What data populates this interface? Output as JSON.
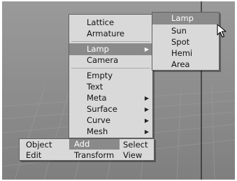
{
  "add_menu": {
    "items": [
      {
        "label": "Lattice"
      },
      {
        "label": "Armature"
      },
      {
        "label": "Lamp"
      },
      {
        "label": "Camera"
      },
      {
        "label": "Empty"
      },
      {
        "label": "Text"
      },
      {
        "label": "Meta"
      },
      {
        "label": "Surface"
      },
      {
        "label": "Curve"
      },
      {
        "label": "Mesh"
      }
    ],
    "highlighted": "Lamp"
  },
  "lamp_submenu": {
    "title": "Lamp",
    "items": [
      {
        "label": "Sun"
      },
      {
        "label": "Spot"
      },
      {
        "label": "Hemi"
      },
      {
        "label": "Area"
      }
    ]
  },
  "header_menu": {
    "row1": {
      "object": "Object",
      "add": "Add",
      "select": "Select"
    },
    "row2": {
      "edit": "Edit",
      "transform": "Transform",
      "view": "View"
    }
  },
  "colors": {
    "menu_bg": "#d9d9d9",
    "highlight": "#8a8a8a",
    "viewport": "#8c8c8c"
  },
  "icons": {
    "submenu_arrow": "triangle-right",
    "cursor": "mouse-pointer"
  }
}
